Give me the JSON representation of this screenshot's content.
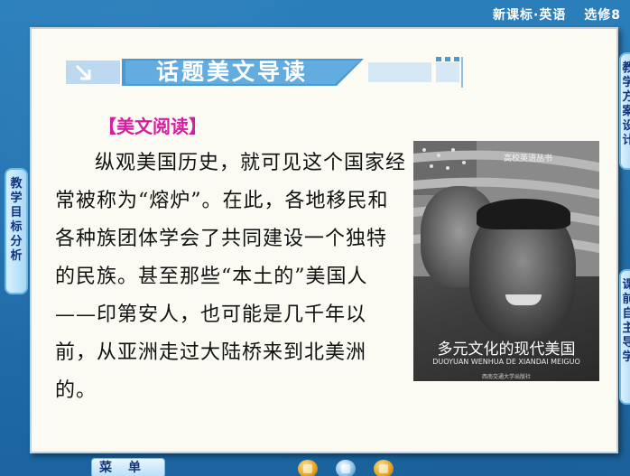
{
  "header": {
    "course": "新课标·英语",
    "volume": "选修8"
  },
  "banner": {
    "title": "话题美文导读"
  },
  "section": {
    "label": "【美文阅读】",
    "paragraph": "纵观美国历史，就可见这个国家经常被称为“熔炉”。在此，各地移民和各种族团体学会了共同建设一个独特的民族。甚至那些“本土的”美国人——印第安人，也可能是几千年以前，从亚洲走过大陆桥来到北美洲的。"
  },
  "book_cover": {
    "series": "高校英语丛书",
    "title": "多元文化的现代美国",
    "subtitle": "DUOYUAN WENHUA DE XIANDAI MEIGUO",
    "publisher": "西南交通大学出版社"
  },
  "side_tabs": {
    "left": "教学目标分析",
    "right_top": "教学方案设计",
    "right_bottom": "课前自主导学"
  },
  "bottom_bar": {
    "menu_label": "菜单"
  },
  "colors": {
    "background": "#1f6fa8",
    "panel": "#fbfbf4",
    "label_magenta": "#d21fa0",
    "tab_text": "#10347a"
  }
}
